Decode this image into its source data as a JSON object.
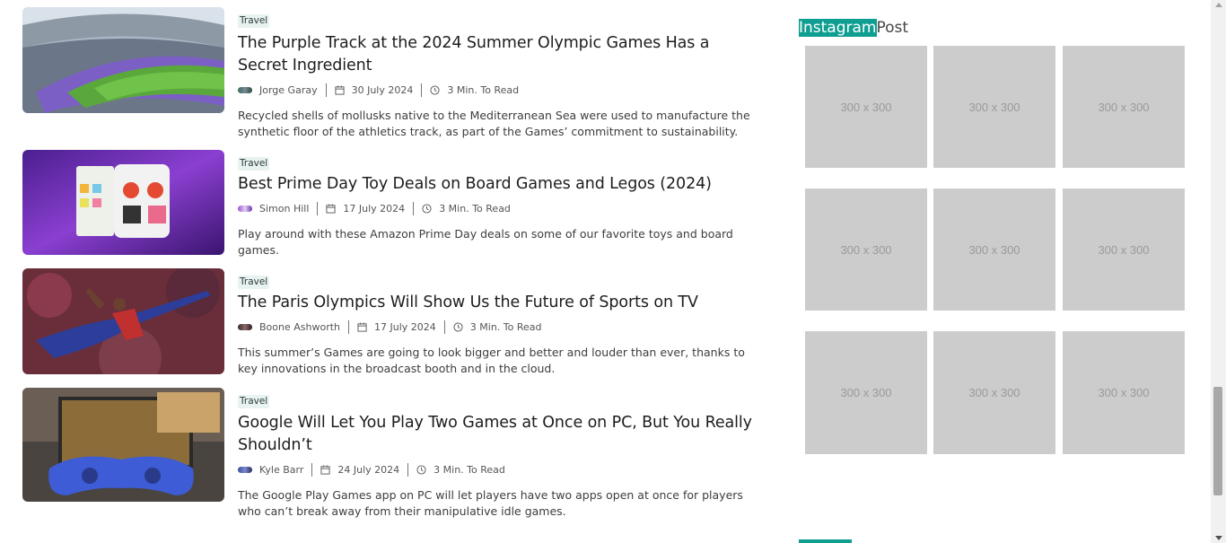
{
  "articles": [
    {
      "category": "Travel",
      "title": "The Purple Track at the 2024 Summer Olympic Games Has a Secret Ingredient",
      "author": "Jorge Garay",
      "date": "30 July 2024",
      "read_time": "3 Min. To Read",
      "excerpt": "Recycled shells of mollusks native to the Mediterranean Sea were used to manufacture the synthetic floor of the athletics track, as part of the Games’ commitment to sustainability."
    },
    {
      "category": "Travel",
      "title": "Best Prime Day Toy Deals on Board Games and Legos (2024)",
      "author": "Simon Hill",
      "date": "17 July 2024",
      "read_time": "3 Min. To Read",
      "excerpt": "Play around with these Amazon Prime Day deals on some of our favorite toys and board games."
    },
    {
      "category": "Travel",
      "title": "The Paris Olympics Will Show Us the Future of Sports on TV",
      "author": "Boone Ashworth",
      "date": "17 July 2024",
      "read_time": "3 Min. To Read",
      "excerpt": "This summer’s Games are going to look bigger and better and louder than ever, thanks to key innovations in the broadcast booth and in the cloud."
    },
    {
      "category": "Travel",
      "title": "Google Will Let You Play Two Games at Once on PC, But You Really Shouldn’t",
      "author": "Kyle Barr",
      "date": "24 July 2024",
      "read_time": "3 Min. To Read",
      "excerpt": "The Google Play Games app on PC will let players have two apps open at once for players who can’t break away from their manipulative idle games."
    }
  ],
  "sidebar": {
    "instagram_title_highlight": "Instagram",
    "instagram_title_rest": "Post",
    "placeholders": [
      "300 x 300",
      "300 x 300",
      "300 x 300",
      "300 x 300",
      "300 x 300",
      "300 x 300",
      "300 x 300",
      "300 x 300",
      "300 x 300"
    ]
  },
  "colors": {
    "accent": "#0f9e92",
    "tag_bg": "#e8f3f1",
    "placeholder_bg": "#cccccc"
  }
}
